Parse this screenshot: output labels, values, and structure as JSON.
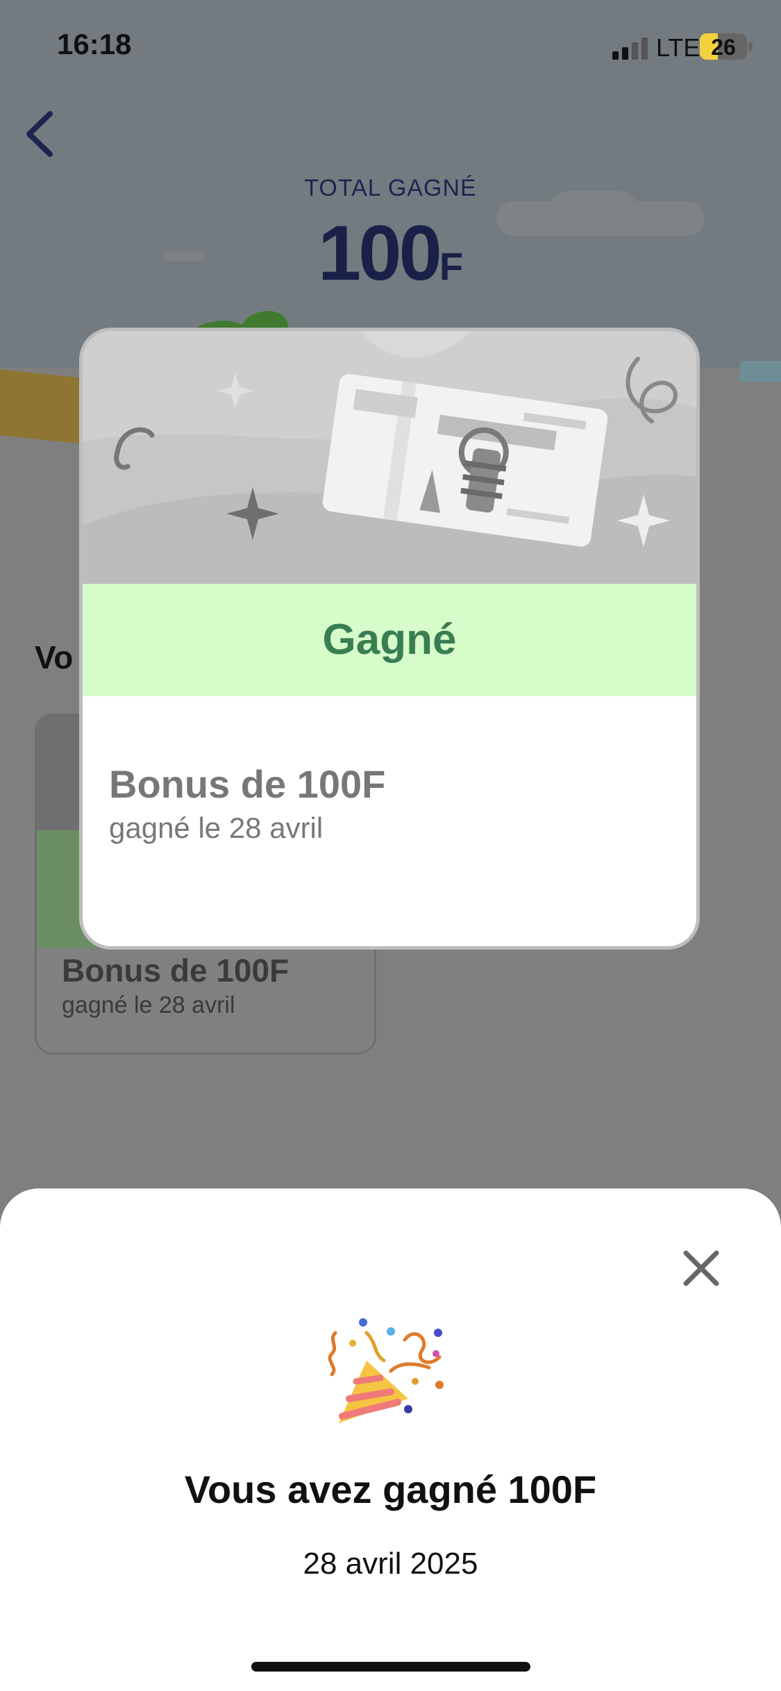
{
  "status_bar": {
    "time": "16:18",
    "network": "LTE",
    "battery": "26"
  },
  "header": {
    "total_label": "TOTAL GAGNÉ",
    "total_amount": "100",
    "total_currency": "F"
  },
  "background": {
    "section_title": "Vo",
    "card": {
      "title": "Bonus de 100F",
      "subtitle": "gagné le 28 avril"
    }
  },
  "popup": {
    "status": "Gagné",
    "title": "Bonus de 100F",
    "subtitle": "gagné le 28 avril"
  },
  "sheet": {
    "title": "Vous avez gagné 100F",
    "date": "28 avril 2025"
  },
  "colors": {
    "banner_bg": "#d5fcc9",
    "banner_text": "#3a7d52",
    "total_text": "#1a2148"
  },
  "icons": {
    "back": "chevron-left-icon",
    "close": "close-icon",
    "celebration": "party-popper-icon",
    "signal": "signal-bars-icon",
    "battery": "battery-icon",
    "banknote": "banknote-icon"
  }
}
